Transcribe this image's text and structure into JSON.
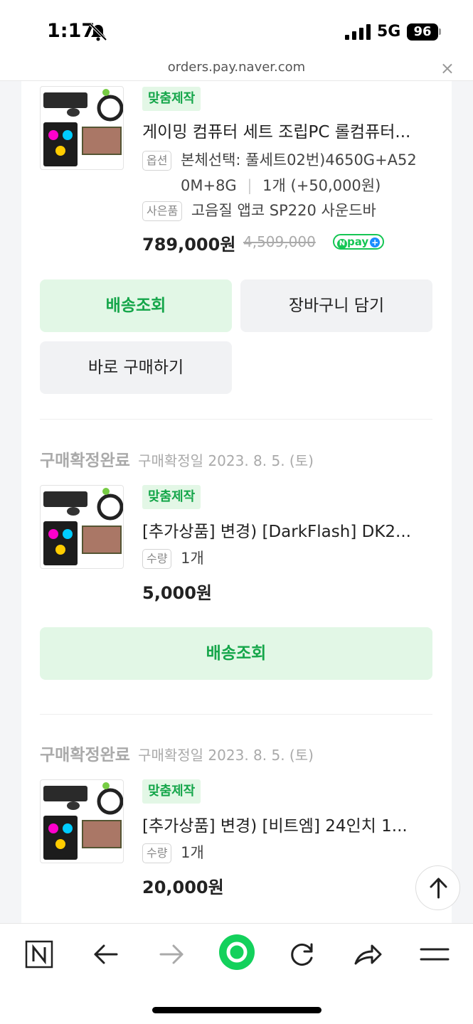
{
  "status_bar": {
    "time": "1:17",
    "network": "5G",
    "battery": "96"
  },
  "url_bar": {
    "url": "orders.pay.naver.com",
    "close": "×"
  },
  "items": [
    {
      "badge": "맞춤제작",
      "title": "게이밍 컴퓨터 세트 조립PC 롤컴퓨터...",
      "option_tag": "옵션",
      "option_line1": "본체선택: 풀세트02번)4650G+A52",
      "option_line2": "0M+8G",
      "option_qty": "1개 (+50,000원)",
      "gift_tag": "사은품",
      "gift": "고음질 앱코 SP220 사운드바",
      "price": "789,000원",
      "original_price": "4,509,000",
      "npay": "pay"
    },
    {
      "status": "구매확정완료",
      "status_date": "구매확정일 2023. 8. 5. (토)",
      "badge": "맞춤제작",
      "title": "[추가상품] 변경) [DarkFlash] DK2...",
      "qty_tag": "수량",
      "qty": "1개",
      "price": "5,000원"
    },
    {
      "status": "구매확정완료",
      "status_date": "구매확정일 2023. 8. 5. (토)",
      "badge": "맞춤제작",
      "title": "[추가상품] 변경) [비트엠] 24인치 1...",
      "qty_tag": "수량",
      "qty": "1개",
      "price": "20,000원"
    }
  ],
  "buttons": {
    "track_delivery": "배송조회",
    "add_to_cart": "장바구니 담기",
    "buy_now": "바로 구매하기"
  },
  "toolbar": {
    "icons": [
      "naver-n-icon",
      "back-arrow-icon",
      "forward-arrow-icon",
      "green-dot-icon",
      "reload-icon",
      "share-icon",
      "menu-icon"
    ]
  },
  "colors": {
    "accent_green": "#15a64a",
    "button_green_bg": "#e2f7e6",
    "npay_green": "#15c654"
  }
}
